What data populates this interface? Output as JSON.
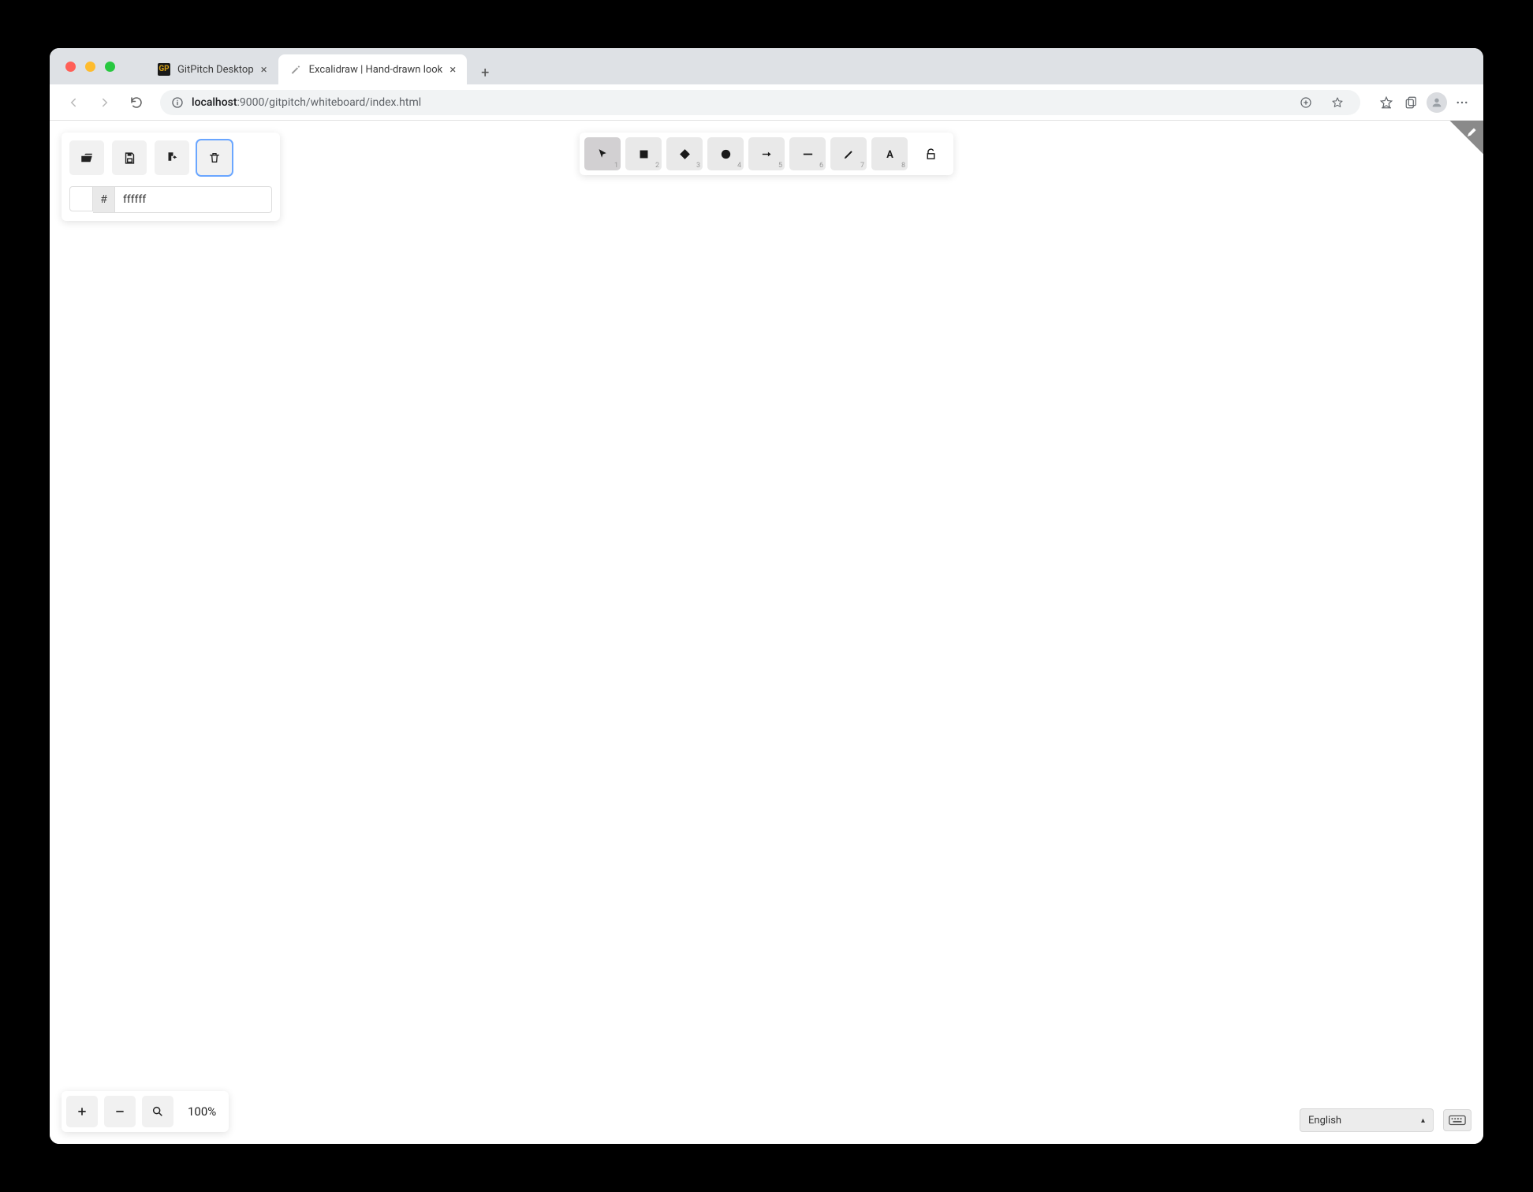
{
  "browser": {
    "tabs": [
      {
        "label": "GitPitch Desktop",
        "active": false
      },
      {
        "label": "Excalidraw | Hand-drawn look",
        "active": true
      }
    ],
    "url_host": "localhost",
    "url_port_path": ":9000/gitpitch/whiteboard/index.html"
  },
  "panel": {
    "color_hash": "#",
    "color_value": "ffffff"
  },
  "tools": {
    "shortcuts": [
      "1",
      "2",
      "3",
      "4",
      "5",
      "6",
      "7",
      "8"
    ]
  },
  "zoom": {
    "label": "100%"
  },
  "lang": {
    "selected": "English"
  }
}
